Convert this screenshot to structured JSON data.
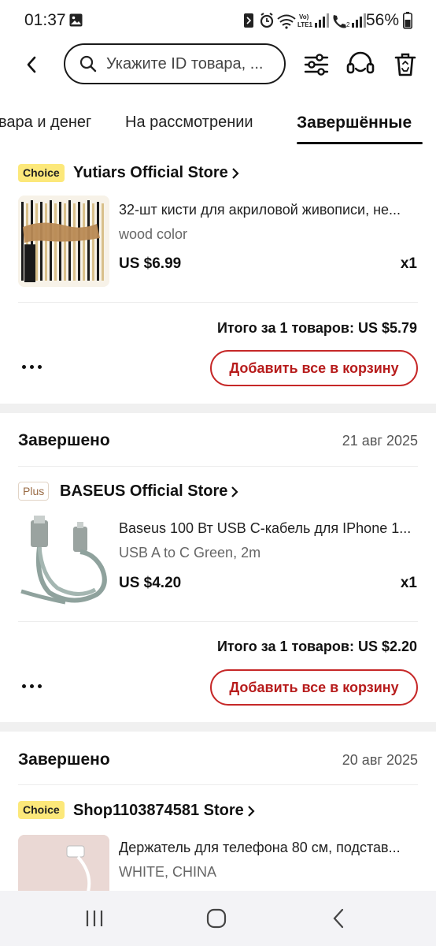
{
  "status_bar": {
    "time": "01:37",
    "battery": "56%",
    "lte_label": "Vo) LTE1",
    "icons": [
      "image-icon",
      "nfc-icon",
      "alarm-icon",
      "wifi-icon",
      "signal-icon",
      "call-icon",
      "signal-icon",
      "battery-icon"
    ]
  },
  "header": {
    "search_placeholder": "Укажите ID товара, ..."
  },
  "tabs": [
    {
      "label": "вара и денег"
    },
    {
      "label": "На рассмотрении"
    },
    {
      "label": "Завершённые",
      "active": true
    }
  ],
  "orders": [
    {
      "badge": "Choice",
      "store": "Yutiars Official Store",
      "item_title": "32-шт кисти для акриловой живописи, не...",
      "item_variant": "wood color",
      "item_price": "US $6.99",
      "item_qty": "x1",
      "total": "Итого за 1 товаров: US $5.79",
      "cart_button": "Добавить все в корзину"
    },
    {
      "status": "Завершено",
      "date": "21 авг 2025",
      "badge": "Plus",
      "store": "BASEUS Official Store",
      "item_title": "Baseus 100 Вт USB C-кабель для IPhone 1...",
      "item_variant": "USB A to C Green, 2m",
      "item_price": "US $4.20",
      "item_qty": "x1",
      "total": "Итого за 1 товаров: US $2.20",
      "cart_button": "Добавить все в корзину"
    },
    {
      "status": "Завершено",
      "date": "20 авг 2025",
      "badge": "Choice",
      "store": "Shop1103874581 Store",
      "item_title": "Держатель для телефона 80 см, подстав...",
      "item_variant": "WHITE, CHINA"
    }
  ],
  "colors": {
    "accent_red": "#c62828",
    "choice_badge": "#fce87a",
    "separator": "#f0f0f0"
  }
}
